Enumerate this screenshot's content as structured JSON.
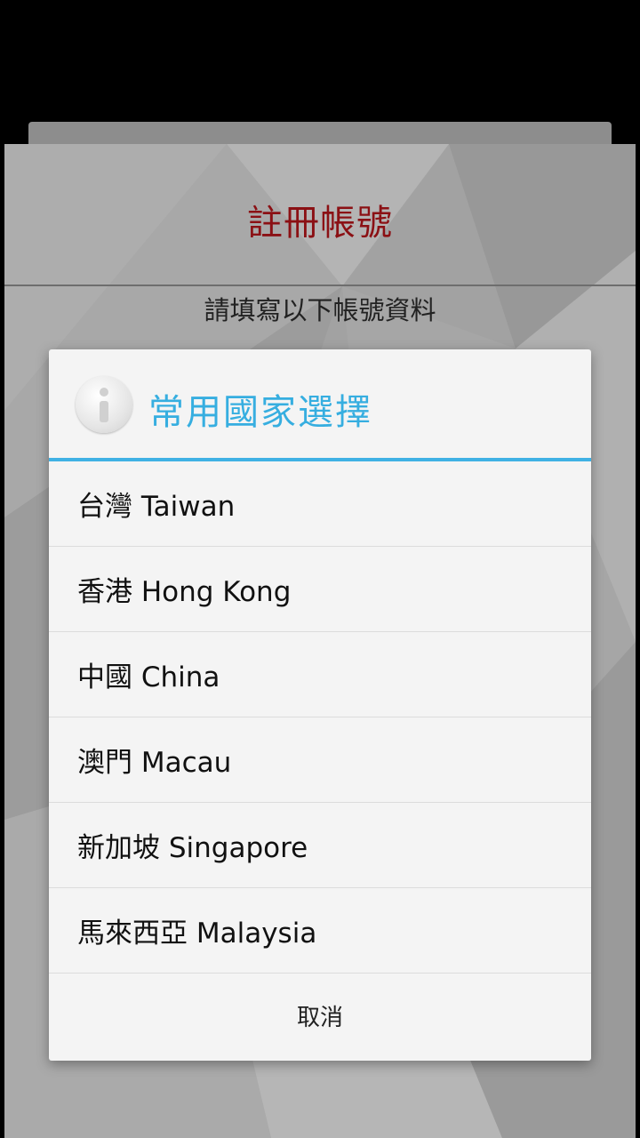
{
  "page": {
    "title": "註冊帳號",
    "subtitle": "請填寫以下帳號資料"
  },
  "dialog": {
    "title": "常用國家選擇",
    "icon": "info-icon",
    "accent_color": "#3fb1e4",
    "countries": [
      {
        "label": "台灣 Taiwan"
      },
      {
        "label": "香港 Hong Kong"
      },
      {
        "label": "中國 China"
      },
      {
        "label": "澳門 Macau"
      },
      {
        "label": "新加坡 Singapore"
      },
      {
        "label": "馬來西亞 Malaysia"
      }
    ],
    "cancel_label": "取消"
  },
  "colors": {
    "title_red": "#8b1014",
    "dialog_bg": "#f4f4f4"
  }
}
